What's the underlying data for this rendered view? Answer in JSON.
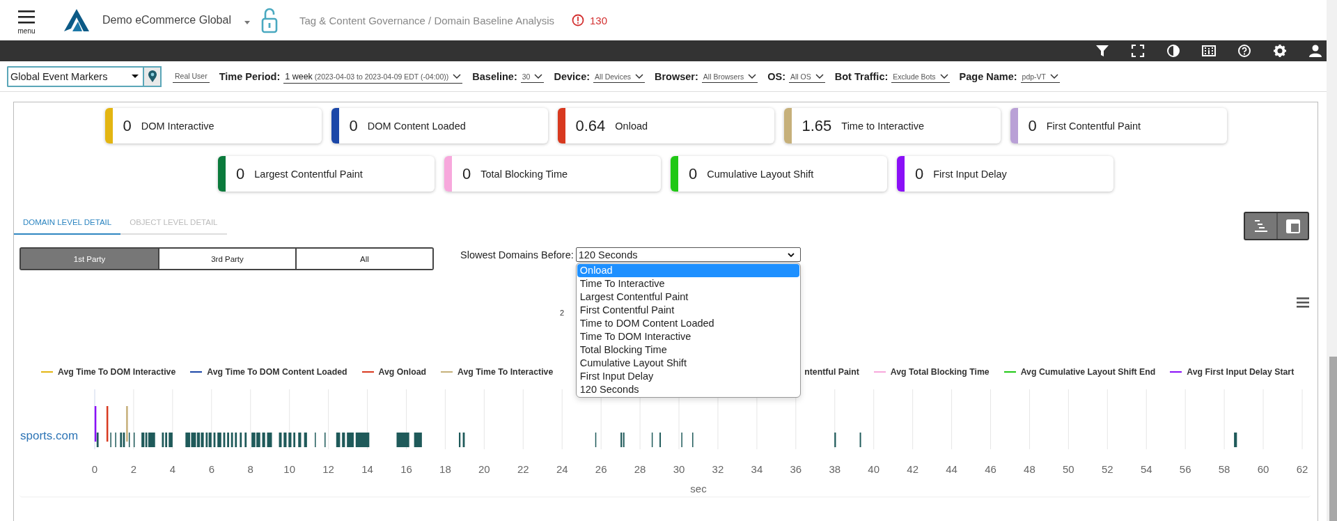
{
  "header": {
    "menu_label": "menu",
    "account": "Demo eCommerce Global",
    "breadcrumb": "Tag & Content Governance / Domain Baseline Analysis",
    "alert_count": "130"
  },
  "filters": {
    "event_markers": "Global Event Markers",
    "mode": "Real User",
    "items": [
      {
        "label": "Time Period:",
        "value": "1 week",
        "detail": "(2023-04-03 to 2023-04-09 EDT (-04:00))"
      },
      {
        "label": "Baseline:",
        "value": "30"
      },
      {
        "label": "Device:",
        "value": "All Devices"
      },
      {
        "label": "Browser:",
        "value": "All Browsers"
      },
      {
        "label": "OS:",
        "value": "All OS"
      },
      {
        "label": "Bot Traffic:",
        "value": "Exclude Bots"
      },
      {
        "label": "Page Name:",
        "value": "pdp-VT"
      }
    ]
  },
  "metric_rows": [
    [
      {
        "value": "0",
        "label": "DOM Interactive",
        "color": "#e3b512"
      },
      {
        "value": "0",
        "label": "DOM Content Loaded",
        "color": "#1b47a8"
      },
      {
        "value": "0.64",
        "label": "Onload",
        "color": "#d8391f"
      },
      {
        "value": "1.65",
        "label": "Time to Interactive",
        "color": "#c6b07a"
      },
      {
        "value": "0",
        "label": "First Contentful Paint",
        "color": "#b9a0d6"
      }
    ],
    [
      {
        "value": "0",
        "label": "Largest Contentful Paint",
        "color": "#0b7a3c"
      },
      {
        "value": "0",
        "label": "Total Blocking Time",
        "color": "#f7a8dc"
      },
      {
        "value": "0",
        "label": "Cumulative Layout Shift",
        "color": "#20c815"
      },
      {
        "value": "0",
        "label": "First Input Delay",
        "color": "#8a10f7"
      }
    ]
  ],
  "tabs": [
    {
      "label": "DOMAIN LEVEL DETAIL",
      "selected": true
    },
    {
      "label": "OBJECT LEVEL DETAIL",
      "selected": false
    }
  ],
  "party_buttons": [
    {
      "label": "1st Party",
      "selected": true
    },
    {
      "label": "3rd Party",
      "selected": false
    },
    {
      "label": "All",
      "selected": false
    }
  ],
  "slowest": {
    "label": "Slowest Domains Before:",
    "value": "120 Seconds",
    "options": [
      {
        "label": "Onload",
        "highlighted": true
      },
      {
        "label": "Time To Interactive",
        "highlighted": false
      },
      {
        "label": "Largest Contentful Paint",
        "highlighted": false
      },
      {
        "label": "First Contentful Paint",
        "highlighted": false
      },
      {
        "label": "Time to DOM Content Loaded",
        "highlighted": false
      },
      {
        "label": "Time To DOM Interactive",
        "highlighted": false
      },
      {
        "label": "Total Blocking Time",
        "highlighted": false
      },
      {
        "label": "Cumulative Layout Shift",
        "highlighted": false
      },
      {
        "label": "First Input Delay",
        "highlighted": false
      },
      {
        "label": "120 Seconds",
        "highlighted": false
      }
    ]
  },
  "chart": {
    "title_fragment": "2",
    "legend": [
      {
        "label": "Avg Time To DOM Interactive",
        "color": "#e3b512"
      },
      {
        "label": "Avg Time To DOM Content Loaded",
        "color": "#1b47a8"
      },
      {
        "label": "Avg Onload",
        "color": "#d8391f"
      },
      {
        "label": "Avg Time To Interactive",
        "color": "#c6b07a"
      },
      {
        "label": "ntentful Paint",
        "kind": "fragment"
      },
      {
        "label": "Avg Total Blocking Time",
        "color": "#f7a8dc"
      },
      {
        "label": "Avg Cumulative Layout Shift End",
        "color": "#20c815"
      },
      {
        "label": "Avg First Input Delay Start",
        "color": "#8a10f7"
      }
    ],
    "timeline": {
      "domain": "sports.com",
      "axis_label": "sec",
      "ticks": [
        "0",
        "2",
        "4",
        "6",
        "8",
        "10",
        "12",
        "14",
        "16",
        "18",
        "20",
        "22",
        "24",
        "26",
        "28",
        "30",
        "32",
        "34",
        "36",
        "38",
        "40",
        "42",
        "44",
        "46",
        "48",
        "50",
        "52",
        "54",
        "56",
        "58",
        "60",
        "62"
      ]
    }
  }
}
